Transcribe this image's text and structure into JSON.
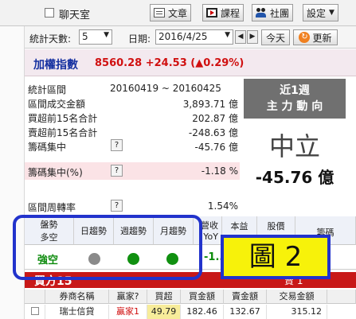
{
  "toolbar": {
    "chat_label": "聊天室",
    "article_label": "文章",
    "course_label": "課程",
    "community_label": "社團",
    "settings_label": "設定"
  },
  "controls": {
    "stat_days_label": "統計天數:",
    "stat_days_value": "5",
    "date_label": "日期:",
    "date_value": "2016/4/25",
    "today_label": "今天",
    "refresh_label": "更新"
  },
  "index": {
    "name": "加權指數",
    "value": "8560.28 +24.53 (▲0.29%)"
  },
  "stats": [
    {
      "key": "統計區間",
      "value": "20160419 ~ 20160425"
    },
    {
      "key": "區間成交金額",
      "value": "3,893.71 億"
    },
    {
      "key": "買超前15名合計",
      "value": "202.87 億"
    },
    {
      "key": "賣超前15名合計",
      "value": "-248.63 億"
    },
    {
      "key": "籌碼集中",
      "value": "-45.76 億"
    },
    {
      "key": "籌碼集中(%)",
      "value": "-1.18 %"
    },
    {
      "key": "區間周轉率",
      "value": "1.54%"
    }
  ],
  "panel": {
    "line1": "近1週",
    "line2": "主 力 動 向",
    "sentiment": "中立",
    "amount": "-45.76 億"
  },
  "trend_table": {
    "headers": [
      "盤勢\n多空",
      "日趨勢",
      "週趨勢",
      "月趨勢",
      "營收\nYoY",
      "本益",
      "股價",
      "籌碼"
    ],
    "row": {
      "stance": "強空",
      "daily_color": "#8a8a8a",
      "weekly_color": "#109010",
      "monthly_color": "#109010",
      "yoy": "-1..."
    }
  },
  "annotation": {
    "figure_label": "圖 2"
  },
  "buy_section": {
    "title": "買方15",
    "tag": "賣 1"
  },
  "broker_table": {
    "headers": [
      "券商名稱",
      "贏家?",
      "買超",
      "買金額",
      "賣金額",
      "交易金額"
    ],
    "row": [
      "瑞士信貸",
      "贏家1",
      "49.79",
      "182.46",
      "132.67",
      "315.12"
    ]
  }
}
